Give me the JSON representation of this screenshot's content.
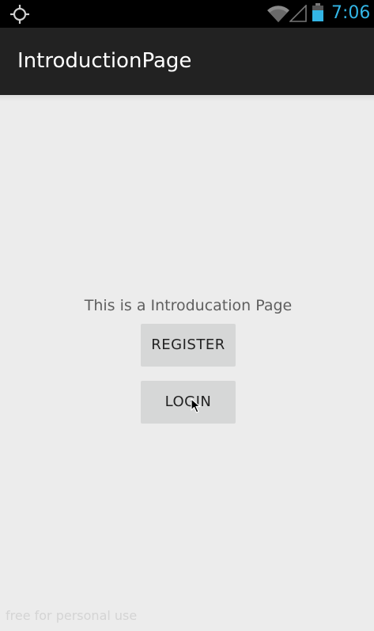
{
  "status_bar": {
    "time": "7:06",
    "icons": [
      "gps-icon",
      "wifi-icon",
      "signal-icon",
      "battery-icon"
    ],
    "time_color": "#33b5e5"
  },
  "action_bar": {
    "title": "IntroductionPage",
    "background": "#222222"
  },
  "content": {
    "intro_text": "This is a Introducation Page",
    "register_label": "REGISTER",
    "login_label": "LOGIN"
  },
  "footer": {
    "watermark": "free for personal use"
  }
}
